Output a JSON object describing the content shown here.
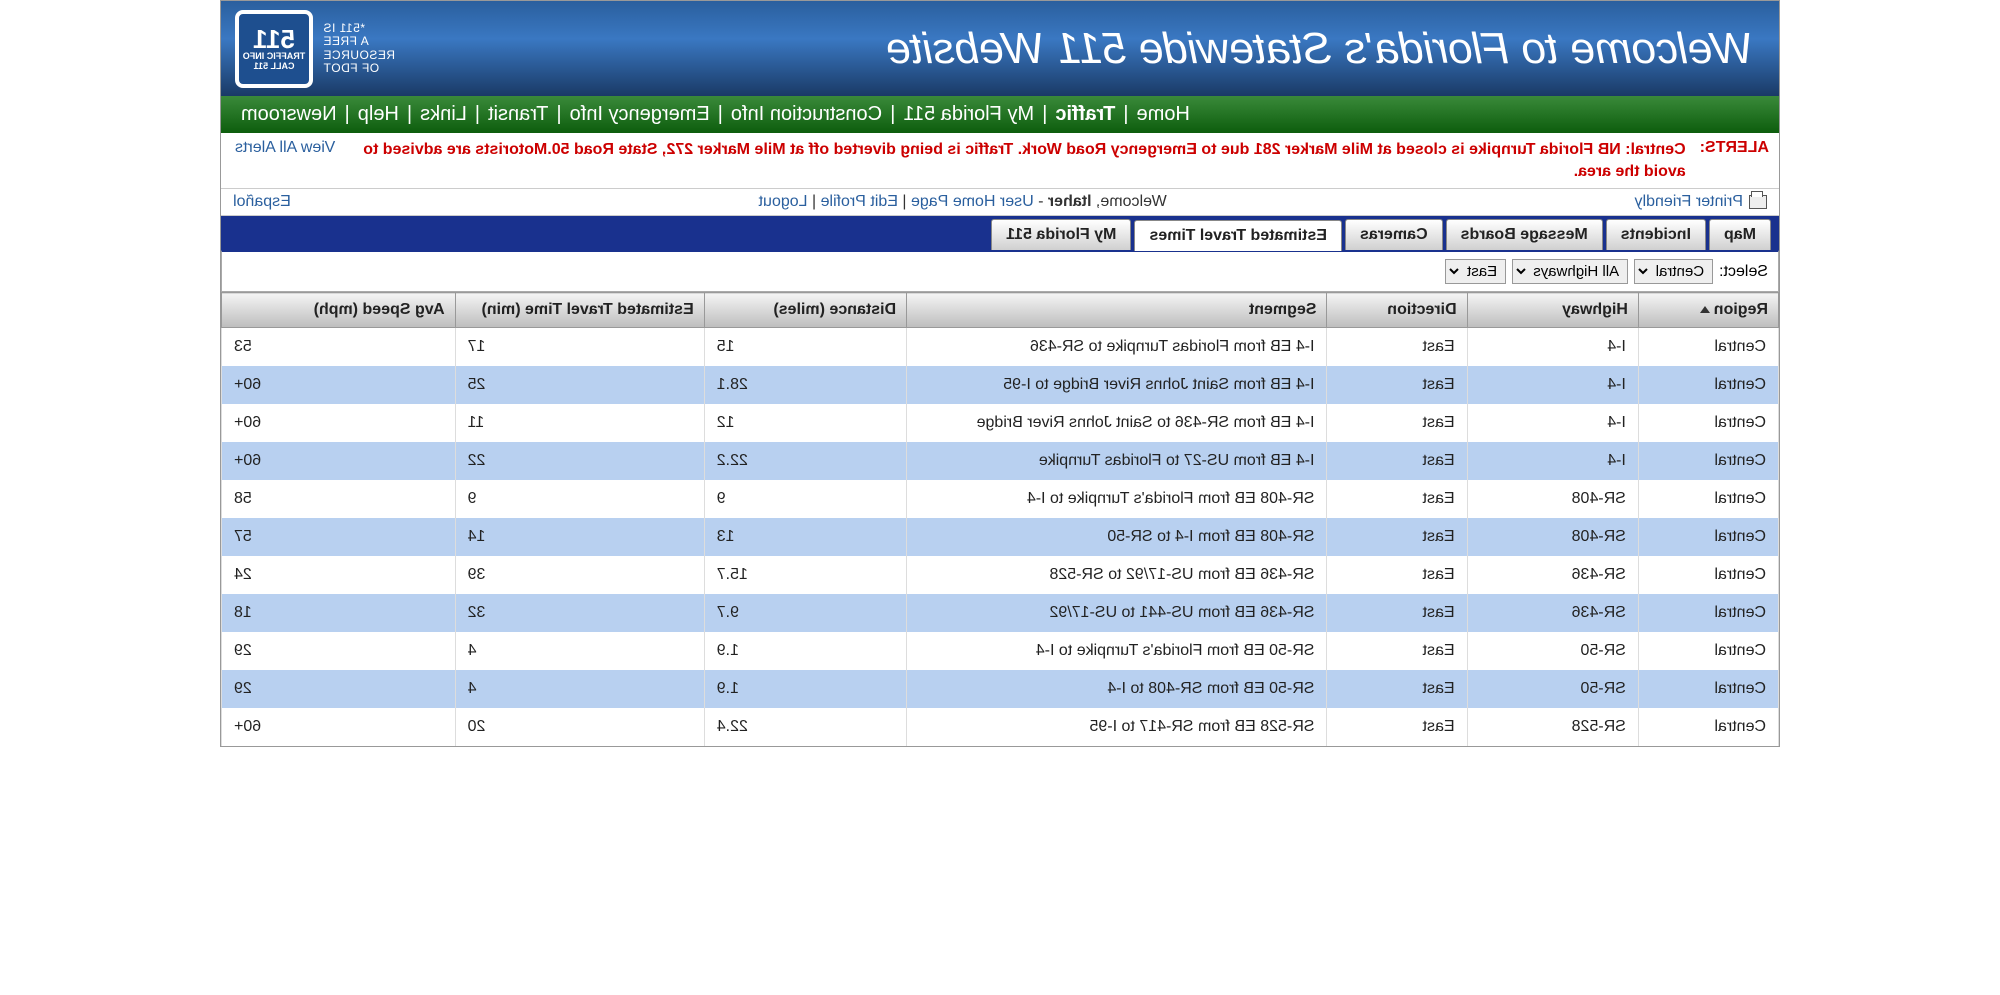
{
  "banner": {
    "title": "Welcome to Florida's Statewide 511 Website",
    "tagline_lines": [
      "*511 IS",
      "A FREE",
      "RESOURCE",
      "OF FDOT"
    ],
    "sign_number": "511",
    "sign_top": "TRAFFIC INFO",
    "sign_bottom": "CALL 511"
  },
  "nav": {
    "items": [
      "Home",
      "Traffic",
      "My Florida 511",
      "Construction Info",
      "Emergency Info",
      "Transit",
      "Links",
      "Help",
      "Newsroom"
    ],
    "active_index": 1
  },
  "alerts": {
    "label": "ALERTS:",
    "text": "Central: NB Florida Turnpike is closed at Mile Marker 281 due to Emergency Road Work. Traffic is being diverted off at Mile Marker 272, State Road 50.Motorists are advised to avoid the area.",
    "view_all": "View All Alerts"
  },
  "util": {
    "printer": "Printer Friendly",
    "welcome_1": "Welcome, ",
    "welcome_user": "ltaher",
    "welcome_2": " - ",
    "links": [
      "User Home Page",
      "Edit Profile",
      "Logout"
    ],
    "espanol": "Español"
  },
  "tabs": {
    "items": [
      "Map",
      "Incidents",
      "Message Boards",
      "Cameras",
      "Estimated Travel Times",
      "My Florida 511"
    ],
    "active_index": 4
  },
  "filter": {
    "label": "Select:",
    "region_options": [
      "Central"
    ],
    "region_selected": "Central",
    "highway_options": [
      "All Highways"
    ],
    "highway_selected": "All Highways",
    "direction_options": [
      "East"
    ],
    "direction_selected": "East"
  },
  "table": {
    "columns": [
      "Region",
      "Highway",
      "Direction",
      "Segment",
      "Distance (miles)",
      "Estimated Travel Time (min)",
      "Avg Speed (mph)"
    ],
    "rows": [
      {
        "region": "Central",
        "highway": "I-4",
        "direction": "East",
        "segment": "I-4 EB from Floridas Turnpike to SR-436",
        "distance": "15",
        "ett": "17",
        "speed": "53"
      },
      {
        "region": "Central",
        "highway": "I-4",
        "direction": "East",
        "segment": "I-4 EB from Saint Johns River Bridge to I-95",
        "distance": "28.1",
        "ett": "25",
        "speed": "60+"
      },
      {
        "region": "Central",
        "highway": "I-4",
        "direction": "East",
        "segment": "I-4 EB from SR-436 to Saint Johns River Bridge",
        "distance": "12",
        "ett": "11",
        "speed": "60+"
      },
      {
        "region": "Central",
        "highway": "I-4",
        "direction": "East",
        "segment": "I-4 EB from US-27 to Floridas Turnpike",
        "distance": "22.2",
        "ett": "22",
        "speed": "60+"
      },
      {
        "region": "Central",
        "highway": "SR-408",
        "direction": "East",
        "segment": "SR-408 EB from Florida's Turnpike to I-4",
        "distance": "9",
        "ett": "9",
        "speed": "58"
      },
      {
        "region": "Central",
        "highway": "SR-408",
        "direction": "East",
        "segment": "SR-408 EB from I-4 to SR-50",
        "distance": "13",
        "ett": "14",
        "speed": "57"
      },
      {
        "region": "Central",
        "highway": "SR-436",
        "direction": "East",
        "segment": "SR-436 EB from US-17/92 to SR-528",
        "distance": "15.7",
        "ett": "39",
        "speed": "24"
      },
      {
        "region": "Central",
        "highway": "SR-436",
        "direction": "East",
        "segment": "SR-436 EB from US-441 to US-17/92",
        "distance": "9.7",
        "ett": "32",
        "speed": "18"
      },
      {
        "region": "Central",
        "highway": "SR-50",
        "direction": "East",
        "segment": "SR-50 EB from Florida's Turnpike to I-4",
        "distance": "1.9",
        "ett": "4",
        "speed": "29"
      },
      {
        "region": "Central",
        "highway": "SR-50",
        "direction": "East",
        "segment": "SR-50 EB from SR-408 to I-4",
        "distance": "1.9",
        "ett": "4",
        "speed": "29"
      },
      {
        "region": "Central",
        "highway": "SR-528",
        "direction": "East",
        "segment": "SR-528 EB from SR-417 to I-95",
        "distance": "22.4",
        "ett": "20",
        "speed": "60+"
      }
    ]
  },
  "chart_data": {
    "type": "table",
    "title": "Estimated Travel Times",
    "columns": [
      "Region",
      "Highway",
      "Direction",
      "Segment",
      "Distance (miles)",
      "Estimated Travel Time (min)",
      "Avg Speed (mph)"
    ],
    "data": [
      [
        "Central",
        "I-4",
        "East",
        "I-4 EB from Floridas Turnpike to SR-436",
        15,
        17,
        53
      ],
      [
        "Central",
        "I-4",
        "East",
        "I-4 EB from Saint Johns River Bridge to I-95",
        28.1,
        25,
        "60+"
      ],
      [
        "Central",
        "I-4",
        "East",
        "I-4 EB from SR-436 to Saint Johns River Bridge",
        12,
        11,
        "60+"
      ],
      [
        "Central",
        "I-4",
        "East",
        "I-4 EB from US-27 to Floridas Turnpike",
        22.2,
        22,
        "60+"
      ],
      [
        "Central",
        "SR-408",
        "East",
        "SR-408 EB from Florida's Turnpike to I-4",
        9,
        9,
        58
      ],
      [
        "Central",
        "SR-408",
        "East",
        "SR-408 EB from I-4 to SR-50",
        13,
        14,
        57
      ],
      [
        "Central",
        "SR-436",
        "East",
        "SR-436 EB from US-17/92 to SR-528",
        15.7,
        39,
        24
      ],
      [
        "Central",
        "SR-436",
        "East",
        "SR-436 EB from US-441 to US-17/92",
        9.7,
        32,
        18
      ],
      [
        "Central",
        "SR-50",
        "East",
        "SR-50 EB from Florida's Turnpike to I-4",
        1.9,
        4,
        29
      ],
      [
        "Central",
        "SR-50",
        "East",
        "SR-50 EB from SR-408 to I-4",
        1.9,
        4,
        29
      ],
      [
        "Central",
        "SR-528",
        "East",
        "SR-528 EB from SR-417 to I-95",
        22.4,
        20,
        "60+"
      ]
    ]
  }
}
